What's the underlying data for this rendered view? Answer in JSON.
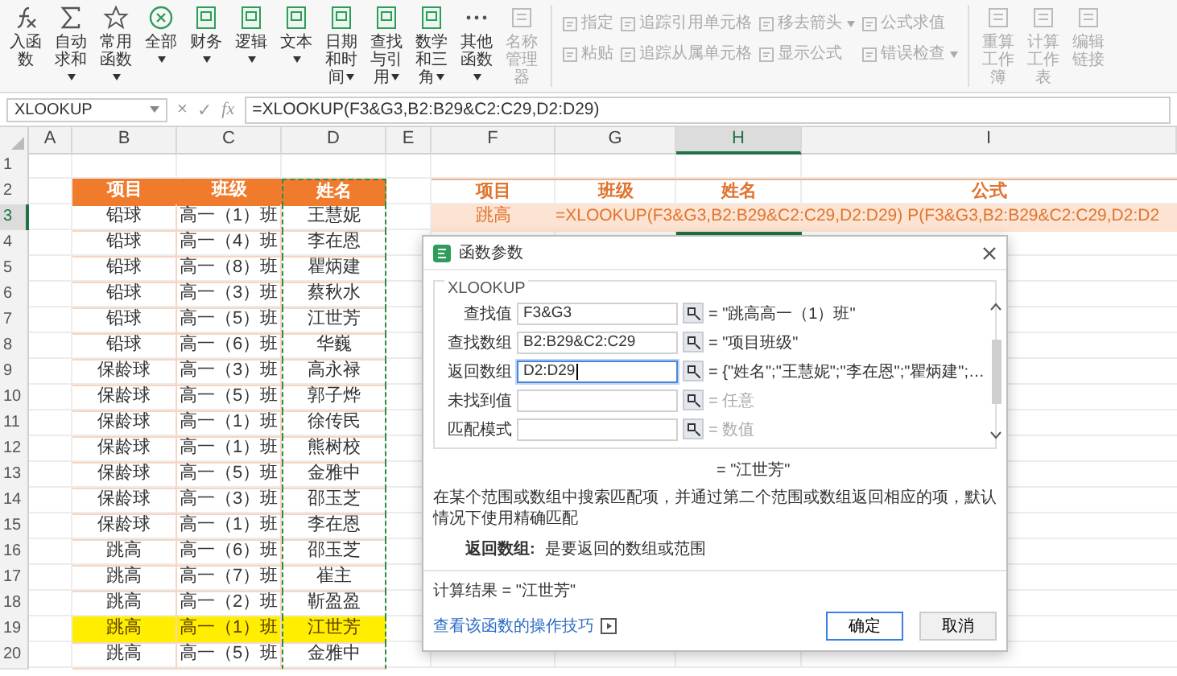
{
  "toolbar": {
    "buttons": [
      {
        "label": "入函数",
        "caret": false,
        "disabled": false
      },
      {
        "label": "自动求和",
        "caret": true,
        "disabled": false
      },
      {
        "label": "常用函数",
        "caret": true,
        "disabled": false
      },
      {
        "label": "全部",
        "caret": true,
        "disabled": false
      },
      {
        "label": "财务",
        "caret": true,
        "disabled": false
      },
      {
        "label": "逻辑",
        "caret": true,
        "disabled": false
      },
      {
        "label": "文本",
        "caret": true,
        "disabled": false
      },
      {
        "label": "日期和时间",
        "caret": true,
        "disabled": false
      },
      {
        "label": "查找与引用",
        "caret": true,
        "disabled": false
      },
      {
        "label": "数学和三角",
        "caret": true,
        "disabled": false
      },
      {
        "label": "其他函数",
        "caret": true,
        "disabled": false
      },
      {
        "label": "名称管理器",
        "caret": false,
        "disabled": true
      }
    ],
    "stacks": [
      [
        {
          "label": "指定",
          "caret": false,
          "disabled": true
        },
        {
          "label": "粘贴",
          "caret": false,
          "disabled": true
        }
      ],
      [
        {
          "label": "追踪引用单元格",
          "caret": false,
          "disabled": true
        },
        {
          "label": "追踪从属单元格",
          "caret": false,
          "disabled": true
        }
      ],
      [
        {
          "label": "移去箭头",
          "caret": true,
          "disabled": true
        },
        {
          "label": "显示公式",
          "caret": false,
          "disabled": true
        }
      ],
      [
        {
          "label": "公式求值",
          "caret": false,
          "disabled": true
        },
        {
          "label": "错误检查",
          "caret": true,
          "disabled": true
        }
      ]
    ],
    "buttons_right": [
      {
        "label": "重算工作簿",
        "caret": false,
        "disabled": true
      },
      {
        "label": "计算工作表",
        "caret": false,
        "disabled": true
      },
      {
        "label": "编辑链接",
        "caret": false,
        "disabled": true
      }
    ]
  },
  "formula_bar": {
    "name_box": "XLOOKUP",
    "cancel": "×",
    "enter": "✓",
    "fx": "fx",
    "formula": "=XLOOKUP(F3&G3,B2:B29&C2:C29,D2:D29)"
  },
  "sheet": {
    "columns": [
      {
        "label": "A",
        "selected": false
      },
      {
        "label": "B",
        "selected": false
      },
      {
        "label": "C",
        "selected": false
      },
      {
        "label": "D",
        "selected": false
      },
      {
        "label": "E",
        "selected": false
      },
      {
        "label": "F",
        "selected": false
      },
      {
        "label": "G",
        "selected": false
      },
      {
        "label": "H",
        "selected": true
      },
      {
        "label": "I",
        "selected": false
      }
    ],
    "rows": [
      {
        "label": "1",
        "selected": false
      },
      {
        "label": "2",
        "selected": false
      },
      {
        "label": "3",
        "selected": true
      },
      {
        "label": "4",
        "selected": false
      },
      {
        "label": "5",
        "selected": false
      },
      {
        "label": "6",
        "selected": false
      },
      {
        "label": "7",
        "selected": false
      },
      {
        "label": "8",
        "selected": false
      },
      {
        "label": "9",
        "selected": false
      },
      {
        "label": "10",
        "selected": false
      },
      {
        "label": "11",
        "selected": false
      },
      {
        "label": "12",
        "selected": false
      },
      {
        "label": "13",
        "selected": false
      },
      {
        "label": "14",
        "selected": false
      },
      {
        "label": "15",
        "selected": false
      },
      {
        "label": "16",
        "selected": false
      },
      {
        "label": "17",
        "selected": false
      },
      {
        "label": "18",
        "selected": false
      },
      {
        "label": "19",
        "selected": false
      },
      {
        "label": "20",
        "selected": false
      }
    ]
  },
  "left_table": {
    "columns": [
      {
        "label": "项目",
        "marquee": false
      },
      {
        "label": "班级",
        "marquee": false
      },
      {
        "label": "姓名",
        "marquee": true
      }
    ],
    "rows": [
      {
        "cells": [
          "铅球",
          "高一（1）班",
          "王慧妮"
        ],
        "highlighted": false
      },
      {
        "cells": [
          "铅球",
          "高一（4）班",
          "李在恩"
        ],
        "highlighted": false
      },
      {
        "cells": [
          "铅球",
          "高一（8）班",
          "瞿炳建"
        ],
        "highlighted": false
      },
      {
        "cells": [
          "铅球",
          "高一（3）班",
          "蔡秋水"
        ],
        "highlighted": false
      },
      {
        "cells": [
          "铅球",
          "高一（5）班",
          "江世芳"
        ],
        "highlighted": false
      },
      {
        "cells": [
          "铅球",
          "高一（6）班",
          "华巍"
        ],
        "highlighted": false
      },
      {
        "cells": [
          "保龄球",
          "高一（3）班",
          "高永禄"
        ],
        "highlighted": false
      },
      {
        "cells": [
          "保龄球",
          "高一（5）班",
          "郭子烨"
        ],
        "highlighted": false
      },
      {
        "cells": [
          "保龄球",
          "高一（1）班",
          "徐传民"
        ],
        "highlighted": false
      },
      {
        "cells": [
          "保龄球",
          "高一（1）班",
          "熊树校"
        ],
        "highlighted": false
      },
      {
        "cells": [
          "保龄球",
          "高一（5）班",
          "金雅中"
        ],
        "highlighted": false
      },
      {
        "cells": [
          "保龄球",
          "高一（3）班",
          "邵玉芝"
        ],
        "highlighted": false
      },
      {
        "cells": [
          "保龄球",
          "高一（1）班",
          "李在恩"
        ],
        "highlighted": false
      },
      {
        "cells": [
          "跳高",
          "高一（6）班",
          "邵玉芝"
        ],
        "highlighted": false
      },
      {
        "cells": [
          "跳高",
          "高一（7）班",
          "崔主"
        ],
        "highlighted": false
      },
      {
        "cells": [
          "跳高",
          "高一（2）班",
          "靳盈盈"
        ],
        "highlighted": false
      },
      {
        "cells": [
          "跳高",
          "高一（1）班",
          "江世芳"
        ],
        "highlighted": true
      },
      {
        "cells": [
          "跳高",
          "高一（5）班",
          "金雅中"
        ],
        "highlighted": false
      }
    ]
  },
  "right_table": {
    "columns": [
      "项目",
      "班级",
      "姓名",
      "公式"
    ],
    "project": "跳高",
    "formula": "=XLOOKUP(F3&G3,B2:B29&C2:C29,D2:D29)",
    "formula_overflow": "P(F3&G3,B2:B29&C2:C29,D2:D2"
  },
  "dialog": {
    "title": "函数参数",
    "function_name": "XLOOKUP",
    "params": [
      {
        "label": "查找值",
        "value": "F3&G3",
        "result": "= \"跳高高一（1）班\"",
        "optional": false,
        "focused": false
      },
      {
        "label": "查找数组",
        "value": "B2:B29&C2:C29",
        "result": "= \"项目班级\"",
        "optional": false,
        "focused": false
      },
      {
        "label": "返回数组",
        "value": "D2:D29",
        "result": "= {\"姓名\";\"王慧妮\";\"李在恩\";\"瞿炳建\";…",
        "optional": false,
        "focused": true
      },
      {
        "label": "未找到值",
        "result": "= 任意",
        "optional": true,
        "focused": false
      },
      {
        "label": "匹配模式",
        "result": "= 数值",
        "optional": true,
        "focused": false
      }
    ],
    "preview": "= \"江世芳\"",
    "description": "在某个范围或数组中搜索匹配项，并通过第二个范围或数组返回相应的项，默认情况下使用精确匹配",
    "help_label": "返回数组:",
    "help_text": "是要返回的数组或范围",
    "calc_result": "计算结果 = \"江世芳\"",
    "link": "查看该函数的操作技巧",
    "buttons": [
      {
        "label": "确定",
        "default": true
      },
      {
        "label": "取消",
        "default": false
      }
    ]
  }
}
